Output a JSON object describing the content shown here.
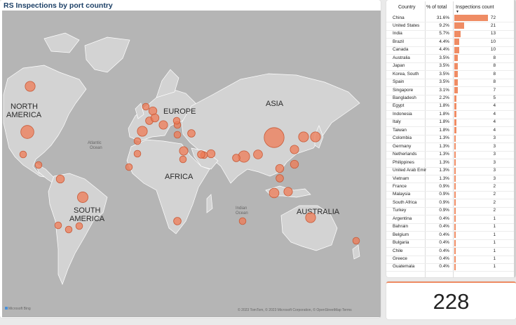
{
  "map": {
    "title": "RS Inspections by port country",
    "labels": {
      "north_america": "NORTH\nAMERICA",
      "south_america": "SOUTH\nAMERICA",
      "europe": "EUROPE",
      "asia": "ASIA",
      "africa": "AFRICA",
      "australia": "AUSTRALIA",
      "atlantic": "Atlantic\nOcean",
      "indian": "Indian\nOcean"
    },
    "bing_logo": "Microsoft Bing",
    "attribution": "© 2023 TomTom, © 2023 Microsoft Corporation, © OpenStreetMap Terms",
    "bubble_color": "#ef7b56"
  },
  "table": {
    "headers": {
      "country": "Country",
      "pct": "% of total",
      "count": "Inspections count"
    },
    "bar_color": "#ef8c64",
    "max_count": 72,
    "rows": [
      {
        "country": "China",
        "pct": "31.6%",
        "count": 72
      },
      {
        "country": "United States",
        "pct": "9.2%",
        "count": 21
      },
      {
        "country": "India",
        "pct": "5.7%",
        "count": 13
      },
      {
        "country": "Brazil",
        "pct": "4.4%",
        "count": 10
      },
      {
        "country": "Canada",
        "pct": "4.4%",
        "count": 10
      },
      {
        "country": "Australia",
        "pct": "3.5%",
        "count": 8
      },
      {
        "country": "Japan",
        "pct": "3.5%",
        "count": 8
      },
      {
        "country": "Korea, South",
        "pct": "3.5%",
        "count": 8
      },
      {
        "country": "Spain",
        "pct": "3.5%",
        "count": 8
      },
      {
        "country": "Singapore",
        "pct": "3.1%",
        "count": 7
      },
      {
        "country": "Bangladesh",
        "pct": "2.2%",
        "count": 5
      },
      {
        "country": "Egypt",
        "pct": "1.8%",
        "count": 4
      },
      {
        "country": "Indonesia",
        "pct": "1.8%",
        "count": 4
      },
      {
        "country": "Italy",
        "pct": "1.8%",
        "count": 4
      },
      {
        "country": "Taiwan",
        "pct": "1.8%",
        "count": 4
      },
      {
        "country": "Colombia",
        "pct": "1.3%",
        "count": 3
      },
      {
        "country": "Germany",
        "pct": "1.3%",
        "count": 3
      },
      {
        "country": "Netherlands",
        "pct": "1.3%",
        "count": 3
      },
      {
        "country": "Philippines",
        "pct": "1.3%",
        "count": 3
      },
      {
        "country": "United Arab Emirates",
        "pct": "1.3%",
        "count": 3
      },
      {
        "country": "Vietnam",
        "pct": "1.3%",
        "count": 3
      },
      {
        "country": "France",
        "pct": "0.9%",
        "count": 2
      },
      {
        "country": "Malaysia",
        "pct": "0.9%",
        "count": 2
      },
      {
        "country": "South Africa",
        "pct": "0.9%",
        "count": 2
      },
      {
        "country": "Turkey",
        "pct": "0.9%",
        "count": 2
      },
      {
        "country": "Argentina",
        "pct": "0.4%",
        "count": 1
      },
      {
        "country": "Bahrain",
        "pct": "0.4%",
        "count": 1
      },
      {
        "country": "Belgium",
        "pct": "0.4%",
        "count": 1
      },
      {
        "country": "Bulgaria",
        "pct": "0.4%",
        "count": 1
      },
      {
        "country": "Chile",
        "pct": "0.4%",
        "count": 1
      },
      {
        "country": "Greece",
        "pct": "0.4%",
        "count": 1
      },
      {
        "country": "Guatemala",
        "pct": "0.4%",
        "count": 1
      }
    ]
  },
  "card": {
    "value": "228"
  }
}
